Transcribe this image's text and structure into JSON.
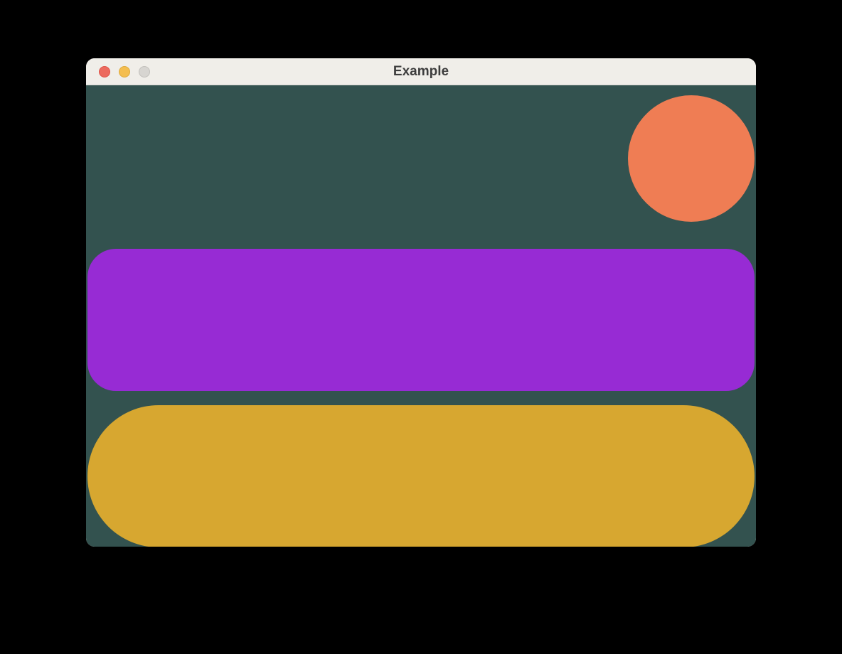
{
  "window": {
    "title": "Example"
  },
  "shapes": {
    "circle": {
      "color": "#ef7d54"
    },
    "bar_purple": {
      "color": "#972bd4"
    },
    "bar_gold": {
      "color": "#d7a730"
    },
    "background": "#33524f"
  }
}
